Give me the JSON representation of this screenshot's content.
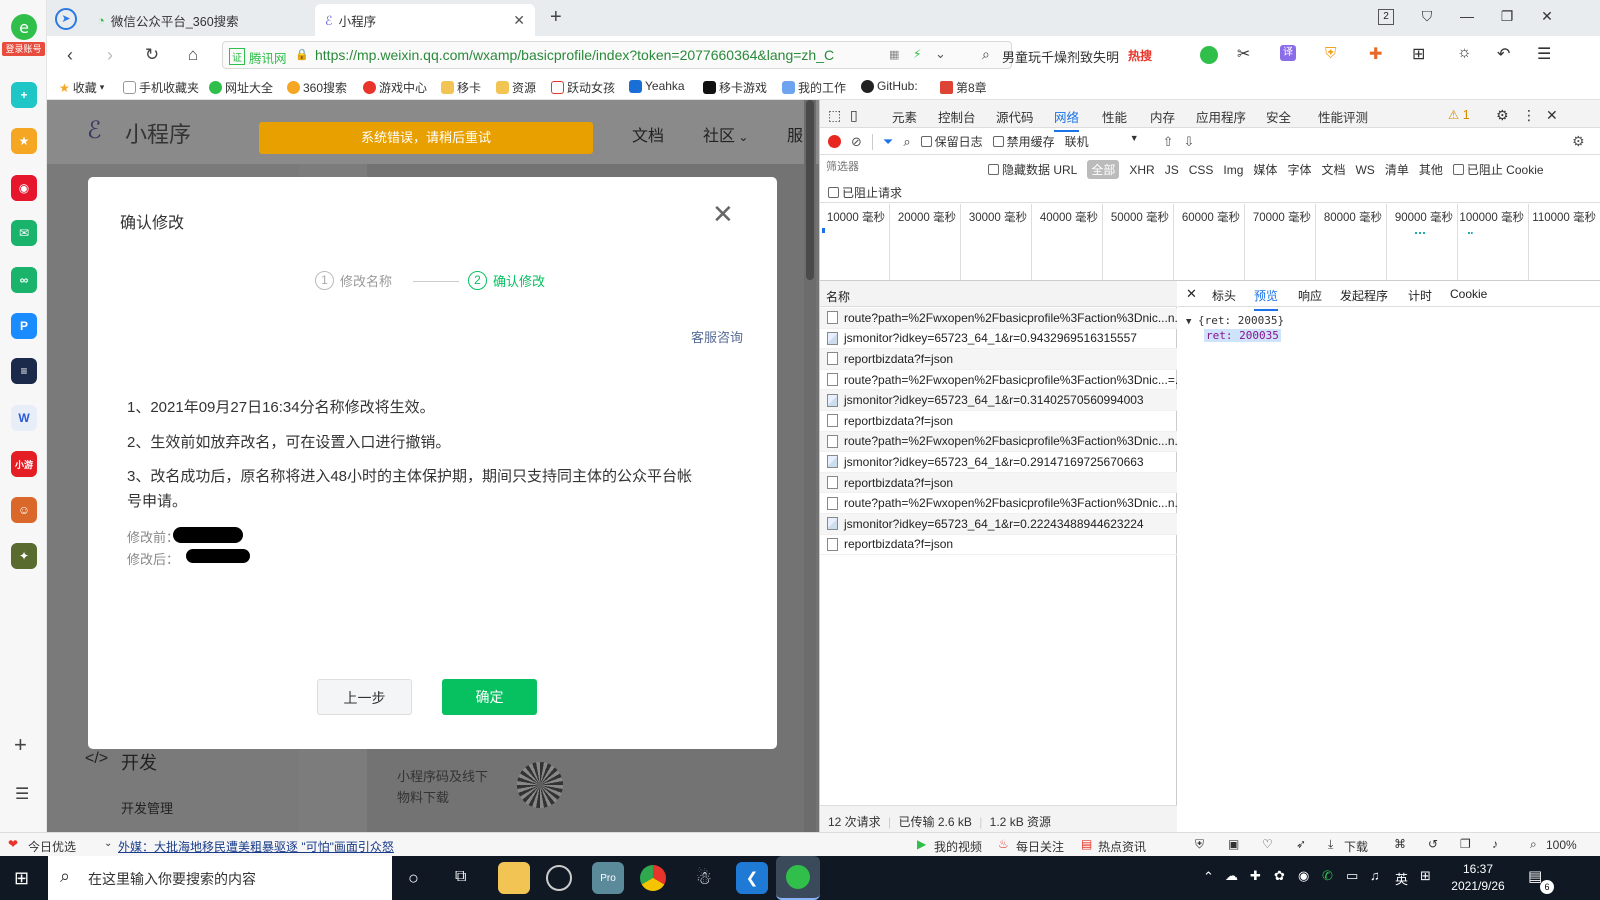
{
  "sidebar": {
    "login_badge": "登录账号"
  },
  "tabs": [
    {
      "title": "微信公众平台_360搜索"
    },
    {
      "title": "小程序"
    }
  ],
  "tab_counter": "2",
  "address": {
    "site_tag": "腾讯网",
    "url": "https://mp.weixin.qq.com/wxamp/basicprofile/index?token=2077660364&lang=zh_C",
    "search_text": "男童玩千燥剂致失明",
    "hot_badge": "热搜"
  },
  "bookmarks": [
    "收藏",
    "手机收藏夹",
    "网址大全",
    "360搜索",
    "游戏中心",
    "移卡",
    "资源",
    "跃动女孩",
    "Yeahka",
    "移卡游戏",
    "我的工作",
    "GitHub:",
    "第8章"
  ],
  "page": {
    "brand": "小程序",
    "error_banner": "系统错误，请稍后重试",
    "nav_items": [
      "文档",
      "社区",
      "服"
    ],
    "sidebar_dev": "开发",
    "sidebar_dev_sub": "开发管理",
    "qr_label_1": "小程序码及线下",
    "qr_label_2": "物料下载"
  },
  "dialog": {
    "title": "确认修改",
    "step1_num": "1",
    "step1_label": "修改名称",
    "step2_num": "2",
    "step2_label": "确认修改",
    "service_link": "客服咨询",
    "line1": "1、2021年09月27日16:34分名称修改将生效。",
    "line2": "2、生效前如放弃改名，可在设置入口进行撤销。",
    "line3a": "3、改名成功后，原名称将进入48小时的主体保护期，期间只支持同主体的公众平台帐",
    "line3b": "号申请。",
    "before_label": "修改前：",
    "after_label": "修改后：",
    "prev_button": "上一步",
    "confirm_button": "确定"
  },
  "devtools": {
    "tabs": [
      "元素",
      "控制台",
      "源代码",
      "网络",
      "性能",
      "内存",
      "应用程序",
      "安全",
      "性能评测"
    ],
    "warning_count": "1",
    "toolbar": {
      "preserve_log": "保留日志",
      "disable_cache": "禁用缓存",
      "throttle": "联机"
    },
    "filter_placeholder": "筛选器",
    "hide_data_url": "隐藏数据 URL",
    "type_filters": [
      "全部",
      "XHR",
      "JS",
      "CSS",
      "Img",
      "媒体",
      "字体",
      "文档",
      "WS",
      "清单",
      "其他"
    ],
    "blocked_cookies": "已阻止 Cookie",
    "blocked_requests": "已阻止请求",
    "timeline_ticks": [
      "10000 毫秒",
      "20000 毫秒",
      "30000 毫秒",
      "40000 毫秒",
      "50000 毫秒",
      "60000 毫秒",
      "70000 毫秒",
      "80000 毫秒",
      "90000 毫秒",
      "100000 毫秒",
      "110000 毫秒"
    ],
    "name_header": "名称",
    "requests": [
      {
        "name": "route?path=%2Fwxopen%2Fbasicprofile%3Faction%3Dnic...n...",
        "type": "doc"
      },
      {
        "name": "jsmonitor?idkey=65723_64_1&r=0.9432969516315557",
        "type": "img"
      },
      {
        "name": "reportbizdata?f=json",
        "type": "doc"
      },
      {
        "name": "route?path=%2Fwxopen%2Fbasicprofile%3Faction%3Dnic...=...",
        "type": "doc"
      },
      {
        "name": "jsmonitor?idkey=65723_64_1&r=0.314025705609940​03",
        "type": "img"
      },
      {
        "name": "reportbizdata?f=json",
        "type": "doc"
      },
      {
        "name": "route?path=%2Fwxopen%2Fbasicprofile%3Faction%3Dnic...n...",
        "type": "doc"
      },
      {
        "name": "jsmonitor?idkey=65723_64_1&r=0.29147169725670663",
        "type": "img"
      },
      {
        "name": "reportbizdata?f=json",
        "type": "doc"
      },
      {
        "name": "route?path=%2Fwxopen%2Fbasicprofile%3Faction%3Dnic...n...",
        "type": "doc"
      },
      {
        "name": "jsmonitor?idkey=65723_64_1&r=0.22243488944623224",
        "type": "img"
      },
      {
        "name": "reportbizdata?f=json",
        "type": "doc"
      }
    ],
    "detail_tabs": [
      "标头",
      "预览",
      "响应",
      "发起程序",
      "计时",
      "Cookie"
    ],
    "preview_summary": "{ret: 200035}",
    "preview_key": "ret: 200035",
    "summary": {
      "requests": "12 次请求",
      "transferred": "已传输 2.6 kB",
      "resources": "1.2 kB 资源"
    }
  },
  "statusbar": {
    "today": "今日优选",
    "news": "外媒：大批海地移民遭美粗暴驱逐 \"可怕\"画面引众怒",
    "my_video": "我的视频",
    "daily": "每日关注",
    "hot": "热点资讯",
    "download": "下载",
    "zoom": "100%"
  },
  "taskbar": {
    "search_placeholder": "在这里输入你要搜索的内容",
    "ime": "英",
    "time": "16:37",
    "date": "2021/9/26",
    "notif_count": "6"
  }
}
